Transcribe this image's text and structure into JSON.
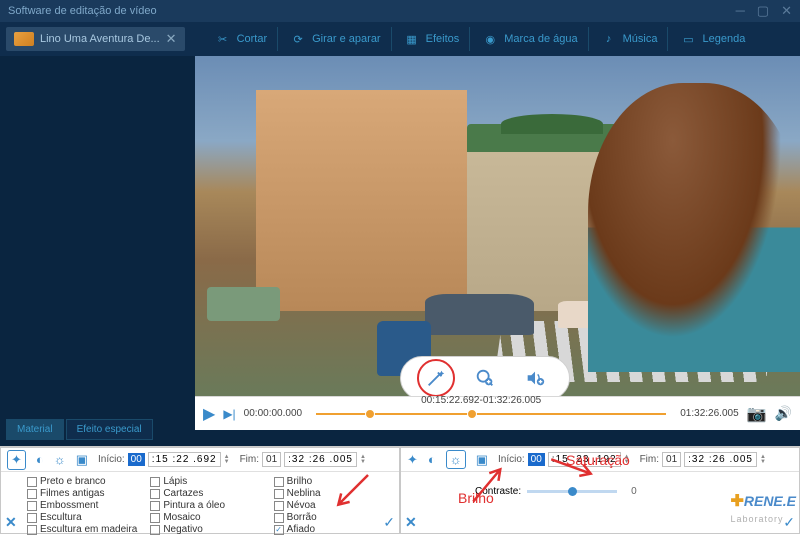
{
  "window": {
    "title": "Software de editação de vídeo"
  },
  "fileTab": {
    "name": "Lino Uma Aventura De..."
  },
  "toolbar": [
    {
      "id": "cortar",
      "label": "Cortar"
    },
    {
      "id": "girar",
      "label": "Girar e aparar"
    },
    {
      "id": "efeitos",
      "label": "Efeitos"
    },
    {
      "id": "marca",
      "label": "Marca de água"
    },
    {
      "id": "musica",
      "label": "Música"
    },
    {
      "id": "legenda",
      "label": "Legenda"
    }
  ],
  "leftTabs": {
    "material": "Material",
    "special": "Efeito especial"
  },
  "balloon": {
    "wand": "✦",
    "zoom": "⊕",
    "vol": "🔊"
  },
  "timeline": {
    "start": "00:00:00.000",
    "mid": "00:15:22.692-01:32:26.005",
    "end": "01:32:26.005"
  },
  "panelLeft": {
    "inicio_lbl": "Início:",
    "inicio_hh": "00",
    "inicio_rest": ":15 :22 .692",
    "fim_lbl": "Fim:",
    "fim_hh": "01",
    "fim_rest": ":32 :26 .005",
    "effects": {
      "c0": [
        "Preto e branco",
        "Filmes antigas",
        "Embossment",
        "Escultura",
        "Escultura em madeira"
      ],
      "c1": [
        "Lápis",
        "Cartazes",
        "Pintura a óleo",
        "Mosaico",
        "Negativo"
      ],
      "c2": [
        "Brilho",
        "Neblina",
        "Névoa",
        "Borrão",
        "Afiado"
      ]
    },
    "checked": "Afiado"
  },
  "panelRight": {
    "inicio_lbl": "Início:",
    "inicio_hh": "00",
    "inicio_rest": ":15 :23 .192",
    "fim_lbl": "Fim:",
    "fim_hh": "01",
    "fim_rest": ":32 :26 .005",
    "contraste_lbl": "Contraste:",
    "contraste_val": "0"
  },
  "annotations": {
    "brilho": "Brilho",
    "saturacao": "Saturação"
  },
  "watermark": {
    "brand": "RENE.E",
    "sub": "Laboratory"
  }
}
